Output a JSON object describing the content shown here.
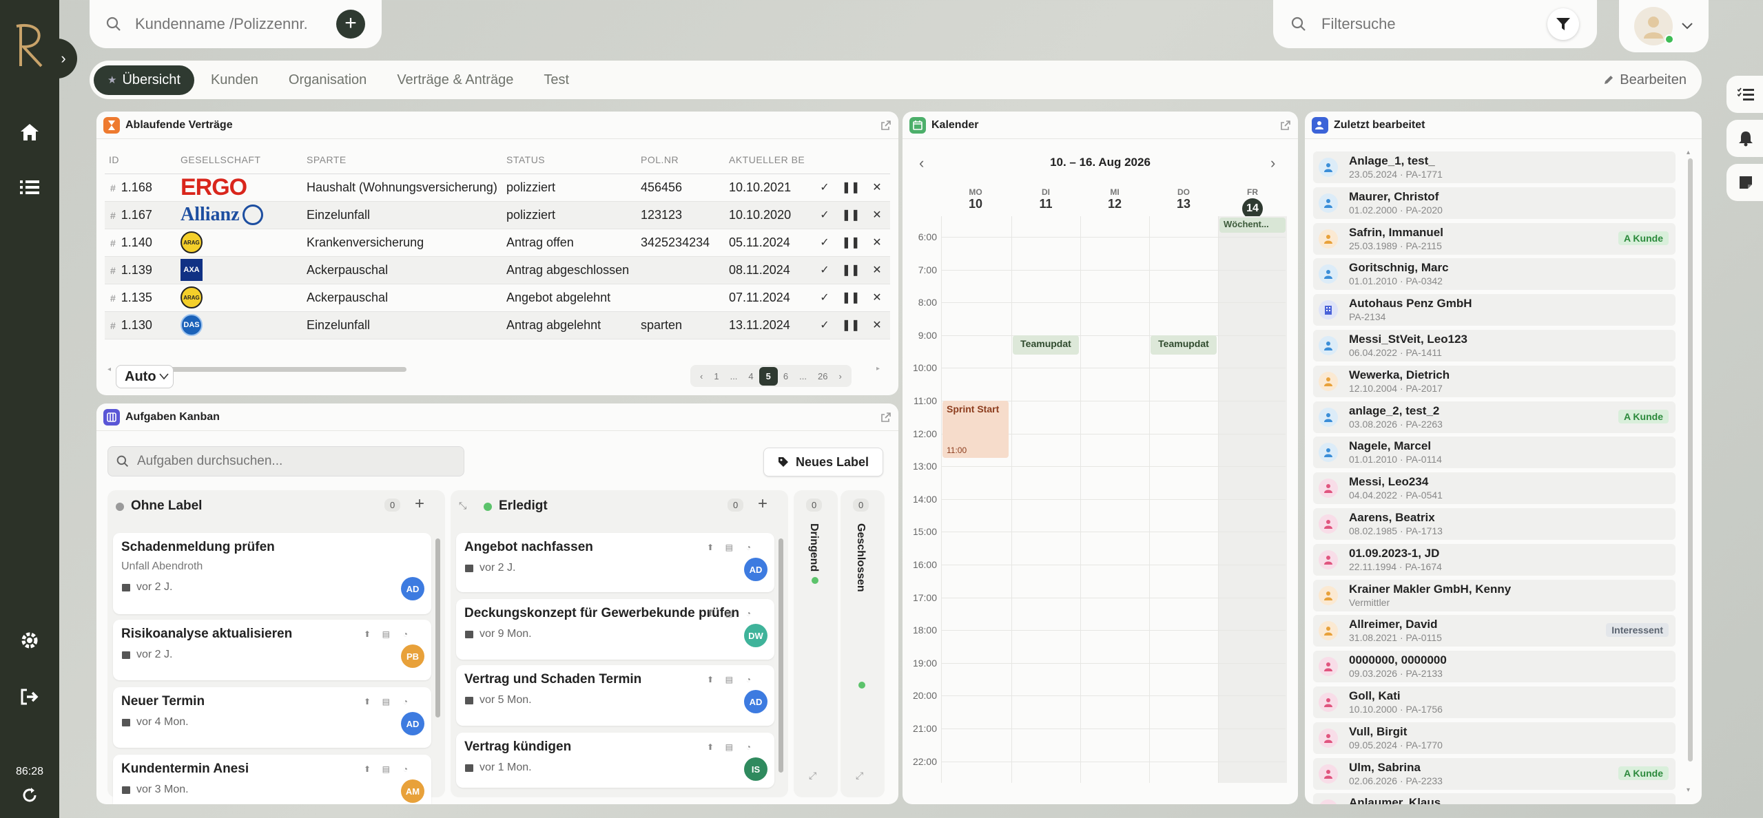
{
  "sidebar": {
    "time": "86:28"
  },
  "search": {
    "placeholder": "Kundenname /Polizzennr. /Sc"
  },
  "filter": {
    "placeholder": "Filtersuche"
  },
  "tabs": [
    {
      "label": "Übersicht"
    },
    {
      "label": "Kunden"
    },
    {
      "label": "Organisation"
    },
    {
      "label": "Verträge & Anträge"
    },
    {
      "label": "Test"
    }
  ],
  "edit_label": "Bearbeiten",
  "contracts": {
    "title": "Ablaufende Verträge",
    "columns": [
      "ID",
      "GESELLSCHAFT",
      "SPARTE",
      "STATUS",
      "POL.NR",
      "AKTUELLER BE"
    ],
    "rows": [
      {
        "id": "1.168",
        "company": "ERGO",
        "sparte": "Haushalt (Wohnungsversicherung)",
        "status": "polizziert",
        "polnr": "456456",
        "date": "10.10.2021"
      },
      {
        "id": "1.167",
        "company": "Allianz",
        "sparte": "Einzelunfall",
        "status": "polizziert",
        "polnr": "123123",
        "date": "10.10.2020"
      },
      {
        "id": "1.140",
        "company": "ARAG",
        "sparte": "Krankenversicherung",
        "status": "Antrag offen",
        "polnr": "3425234234",
        "date": "05.11.2024"
      },
      {
        "id": "1.139",
        "company": "AXA",
        "sparte": "Ackerpauschal",
        "status": "Antrag abgeschlossen",
        "polnr": "",
        "date": "08.11.2024"
      },
      {
        "id": "1.135",
        "company": "ARAG",
        "sparte": "Ackerpauschal",
        "status": "Angebot abgelehnt",
        "polnr": "",
        "date": "07.11.2024"
      },
      {
        "id": "1.130",
        "company": "DAS",
        "sparte": "Einzelunfall",
        "status": "Antrag abgelehnt",
        "polnr": "sparten",
        "date": "13.11.2024"
      }
    ],
    "page_size": "Auto",
    "pages": [
      "1",
      "...",
      "4",
      "5",
      "6",
      "...",
      "26"
    ],
    "current_page": "5"
  },
  "kanban": {
    "title": "Aufgaben Kanban",
    "search_placeholder": "Aufgaben durchsuchen...",
    "new_label": "Neues Label",
    "columns": [
      {
        "name": "Ohne Label",
        "count": "0",
        "dot": "#9a9a9a",
        "cards": [
          {
            "title": "Schadenmeldung prüfen",
            "sub": "Unfall Abendroth",
            "date": "vor 2 J.",
            "avatar": "AD",
            "color": "#3d7be0"
          },
          {
            "title": "Risikoanalyse aktualisieren",
            "sub": "",
            "date": "vor 2 J.",
            "avatar": "PB",
            "color": "#e8a13a"
          },
          {
            "title": "Neuer Termin",
            "sub": "",
            "date": "vor 4 Mon.",
            "avatar": "AD",
            "color": "#3d7be0"
          },
          {
            "title": "Kundentermin Anesi",
            "sub": "",
            "date": "vor 3 Mon.",
            "avatar": "AM",
            "color": "#e8a13a"
          }
        ]
      },
      {
        "name": "Erledigt",
        "count": "0",
        "dot": "#5cc36b",
        "cards": [
          {
            "title": "Angebot nachfassen",
            "sub": "",
            "date": "vor 2 J.",
            "avatar": "AD",
            "color": "#3d7be0"
          },
          {
            "title": "Deckungskonzept für Gewerbekunde prüfen",
            "sub": "",
            "date": "vor 9 Mon.",
            "avatar": "DW",
            "color": "#3fb39a"
          },
          {
            "title": "Vertrag und Schaden Termin",
            "sub": "",
            "date": "vor 5 Mon.",
            "avatar": "AD",
            "color": "#3d7be0"
          },
          {
            "title": "Vertrag kündigen",
            "sub": "",
            "date": "vor 1 Mon.",
            "avatar": "IS",
            "color": "#2f8a5e"
          }
        ]
      },
      {
        "name": "Dringend",
        "count": "0"
      },
      {
        "name": "Geschlossen",
        "count": "0"
      }
    ]
  },
  "calendar": {
    "title": "Kalender",
    "range": "10. – 16. Aug 2026",
    "days": [
      {
        "name": "MO",
        "num": "10"
      },
      {
        "name": "DI",
        "num": "11"
      },
      {
        "name": "MI",
        "num": "12"
      },
      {
        "name": "DO",
        "num": "13"
      },
      {
        "name": "FR",
        "num": "14"
      }
    ],
    "hours": [
      "6:00",
      "7:00",
      "8:00",
      "9:00",
      "10:00",
      "11:00",
      "12:00",
      "13:00",
      "14:00",
      "15:00",
      "16:00",
      "17:00",
      "18:00",
      "19:00",
      "20:00",
      "21:00",
      "22:00"
    ],
    "events": [
      {
        "title": "Wöchent...",
        "day": 4,
        "allday": true
      },
      {
        "title": "Teamupdat",
        "day": 1,
        "start": 9.0,
        "end": 9.6
      },
      {
        "title": "Teamupdat",
        "day": 3,
        "start": 9.0,
        "end": 9.6
      },
      {
        "title": "Sprint Start",
        "time": "11:00",
        "day": 0,
        "start": 11.0,
        "end": 12.75
      }
    ]
  },
  "recent": {
    "title": "Zuletzt bearbeitet",
    "items": [
      {
        "name": "Anlage_1, test_",
        "sub": "23.05.2024 · PA-1771",
        "type": "person",
        "tag": ""
      },
      {
        "name": "Maurer, Christof",
        "sub": "01.02.2000 · PA-2020",
        "type": "person",
        "tag": ""
      },
      {
        "name": "Safrin, Immanuel",
        "sub": "25.03.1989 · PA-2115",
        "type": "person-orange",
        "tag": "A Kunde"
      },
      {
        "name": "Goritschnig, Marc",
        "sub": "01.01.2010 · PA-0342",
        "type": "person",
        "tag": ""
      },
      {
        "name": "Autohaus Penz GmbH",
        "sub": "PA-2134",
        "type": "company",
        "tag": ""
      },
      {
        "name": "Messi_StVeit, Leo123",
        "sub": "06.04.2022 · PA-1411",
        "type": "person",
        "tag": ""
      },
      {
        "name": "Wewerka, Dietrich",
        "sub": "12.10.2004 · PA-2017",
        "type": "person-orange",
        "tag": ""
      },
      {
        "name": "anlage_2, test_2",
        "sub": "03.08.2026 · PA-2263",
        "type": "person",
        "tag": "A Kunde"
      },
      {
        "name": "Nagele, Marcel",
        "sub": "01.01.2010 · PA-0114",
        "type": "person",
        "tag": ""
      },
      {
        "name": "Messi, Leo234",
        "sub": "04.04.2022 · PA-0541",
        "type": "person-pink",
        "tag": ""
      },
      {
        "name": "Aarens, Beatrix",
        "sub": "08.02.1985 · PA-1713",
        "type": "person-pink",
        "tag": ""
      },
      {
        "name": "01.09.2023-1, JD",
        "sub": "22.11.1994 · PA-1674",
        "type": "person-pink",
        "tag": ""
      },
      {
        "name": "Krainer Makler GmbH, Kenny",
        "sub": "Vermittler",
        "type": "person-orange",
        "tag": ""
      },
      {
        "name": "Allreimer, David",
        "sub": "31.08.2021 · PA-0115",
        "type": "person-orange",
        "tag": "Interessent"
      },
      {
        "name": "0000000, 0000000",
        "sub": "09.03.2026 · PA-2133",
        "type": "person-pink",
        "tag": ""
      },
      {
        "name": "Goll, Kati",
        "sub": "10.10.2000 · PA-1756",
        "type": "person-pink",
        "tag": ""
      },
      {
        "name": "Vull, Birgit",
        "sub": "09.05.2024 · PA-1770",
        "type": "person-pink",
        "tag": ""
      },
      {
        "name": "Ulm, Sabrina",
        "sub": "02.06.2026 · PA-2233",
        "type": "person-pink",
        "tag": "A Kunde"
      },
      {
        "name": "Anlaumer, Klaus",
        "sub": "",
        "type": "person-pink",
        "tag": ""
      }
    ]
  }
}
